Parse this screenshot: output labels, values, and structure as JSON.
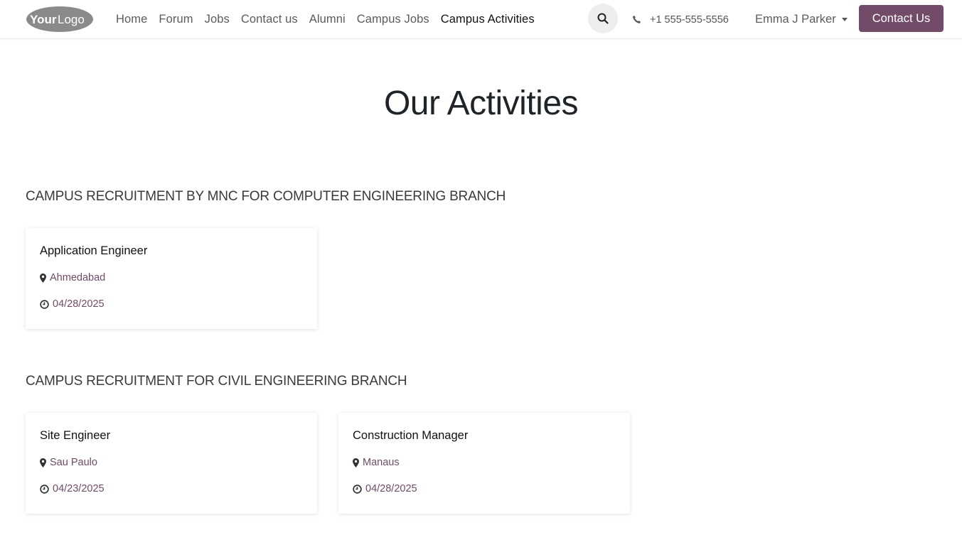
{
  "header": {
    "logo_text": "YourLogo",
    "nav": [
      {
        "label": "Home"
      },
      {
        "label": "Forum"
      },
      {
        "label": "Jobs"
      },
      {
        "label": "Contact us"
      },
      {
        "label": "Alumni"
      },
      {
        "label": "Campus Jobs"
      },
      {
        "label": "Campus Activities"
      }
    ],
    "active_nav": "Campus Activities",
    "phone": "+1 555-555-5556",
    "user_name": "Emma J Parker",
    "contact_button": "Contact Us",
    "accent_color": "#714b67"
  },
  "main": {
    "title": "Our Activities",
    "sections": [
      {
        "title": "CAMPUS RECRUITMENT BY MNC FOR COMPUTER ENGINEERING BRANCH",
        "jobs": [
          {
            "title": "Application Engineer",
            "location": "Ahmedabad",
            "date": "04/28/2025"
          }
        ]
      },
      {
        "title": "CAMPUS RECRUITMENT FOR CIVIL ENGINEERING BRANCH",
        "jobs": [
          {
            "title": "Site Engineer",
            "location": "Sau Paulo",
            "date": "04/23/2025"
          },
          {
            "title": "Construction Manager",
            "location": "Manaus",
            "date": "04/28/2025"
          }
        ]
      }
    ]
  }
}
